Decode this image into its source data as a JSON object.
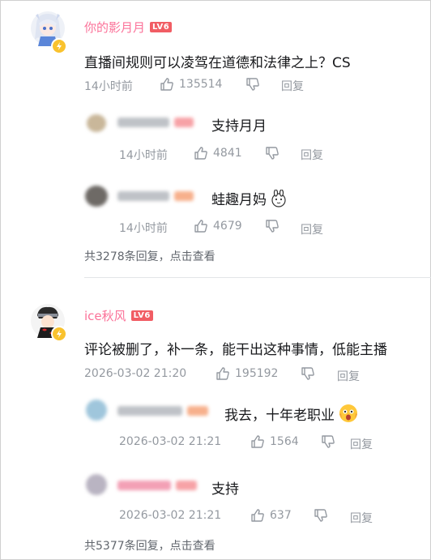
{
  "comments": [
    {
      "username": "你的影月月",
      "level": "LV6",
      "content": "直播间规则可以凌驾在道德和法律之上？CS",
      "time": "14小时前",
      "likes": "135514",
      "reply_label": "回复",
      "replies": [
        {
          "content": "支持月月",
          "time": "14小时前",
          "likes": "4841",
          "reply_label": "回复"
        },
        {
          "content": "蛙趣月妈",
          "time": "14小时前",
          "likes": "4679",
          "reply_label": "回复"
        }
      ],
      "footer": "共3278条回复，点击查看"
    },
    {
      "username": "ice秋风",
      "level": "LV6",
      "content": "评论被删了，补一条，能干出这种事情，低能主播",
      "time": "2026-03-02 21:20",
      "likes": "195192",
      "reply_label": "回复",
      "replies": [
        {
          "content": "我去，十年老职业",
          "time": "2026-03-02 21:21",
          "likes": "1564",
          "reply_label": "回复"
        },
        {
          "content": "支持",
          "time": "2026-03-02 21:21",
          "likes": "637",
          "reply_label": "回复"
        }
      ],
      "footer": "共5377条回复，点击查看"
    }
  ],
  "colors": {
    "username": "#fb7299",
    "level_badge": "#f15d64",
    "meta": "#9499a0",
    "badge_yellow": "#f9c22e"
  }
}
